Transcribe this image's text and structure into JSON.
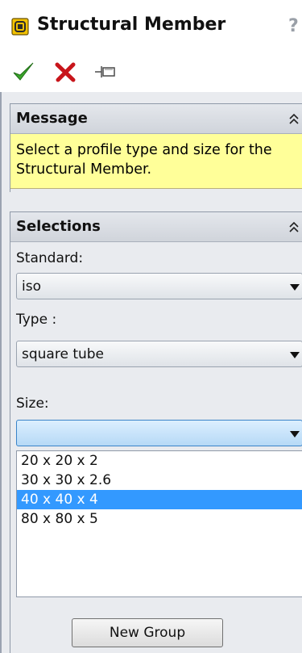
{
  "title": "Structural Member",
  "help_icon_text": "?",
  "toolbar": {
    "ok_icon": "green-checkmark-icon",
    "cancel_icon": "red-x-icon",
    "pin_icon": "pushpin-icon"
  },
  "message": {
    "title": "Message",
    "text": "Select a profile type and size for the Structural Member."
  },
  "selections": {
    "title": "Selections",
    "standard": {
      "label": "Standard:",
      "value": "iso"
    },
    "type": {
      "label": "Type :",
      "value": "square tube"
    },
    "size": {
      "label": "Size:",
      "value": "",
      "options": [
        "20 x 20 x 2",
        "30 x 30 x 2.6",
        "40 x 40 x 4",
        "80 x 80 x 5"
      ],
      "highlighted": "40 x 40 x 4"
    },
    "new_group_label": "New Group"
  },
  "colors": {
    "message_bg": "#ffff99",
    "highlight": "#3399ff",
    "header_gradient_top": "#e4e7ec",
    "header_gradient_bottom": "#d0d4db"
  }
}
